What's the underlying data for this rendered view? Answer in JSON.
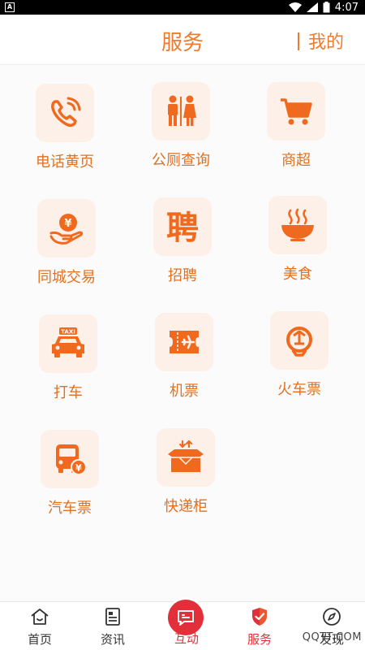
{
  "status_bar": {
    "time": "4:07",
    "app_badge": "A"
  },
  "header": {
    "title": "服务",
    "mine": "我的"
  },
  "services": [
    {
      "label": "电话黄页",
      "icon": "phone-icon"
    },
    {
      "label": "公厕查询",
      "icon": "restroom-icon"
    },
    {
      "label": "商超",
      "icon": "shopping-cart-icon"
    },
    {
      "label": "同城交易",
      "icon": "yuan-hand-icon"
    },
    {
      "label": "招聘",
      "icon": "recruit-icon",
      "icon_text": "聘"
    },
    {
      "label": "美食",
      "icon": "food-bowl-icon"
    },
    {
      "label": "打车",
      "icon": "taxi-icon",
      "icon_text": "TAXI"
    },
    {
      "label": "机票",
      "icon": "plane-ticket-icon"
    },
    {
      "label": "火车票",
      "icon": "train-icon"
    },
    {
      "label": "汽车票",
      "icon": "bus-icon"
    },
    {
      "label": "快递柜",
      "icon": "parcel-box-icon"
    }
  ],
  "bottom_nav": {
    "home": "首页",
    "news": "资讯",
    "interact": "互动",
    "service": "服务",
    "discover": "发现"
  },
  "watermark": "QQTT.COM",
  "colors": {
    "accent": "#f07a2d",
    "icon_bg": "#fdf0e8",
    "active_nav": "#e2303a"
  }
}
